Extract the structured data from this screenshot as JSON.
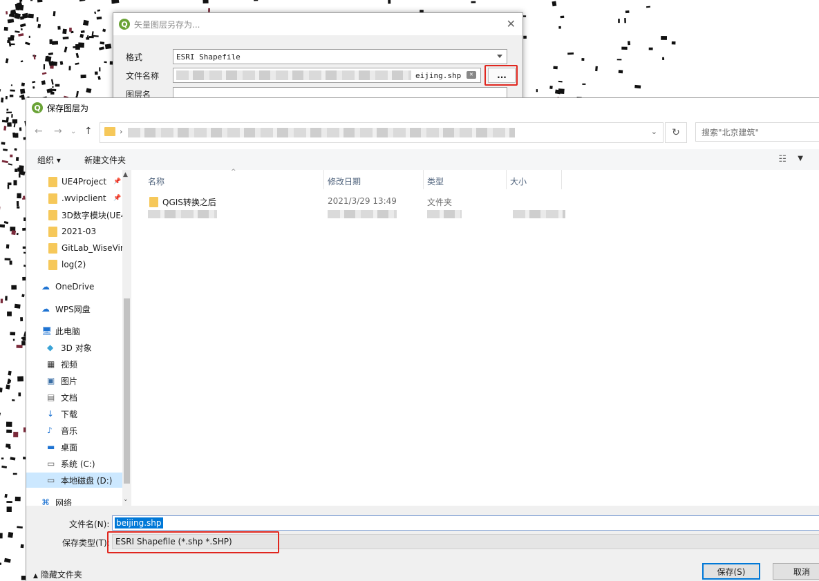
{
  "qgis_dialog": {
    "title": "矢量图层另存为...",
    "format_label": "格式",
    "format_value": "ESRI Shapefile",
    "filename_label": "文件名称",
    "filename_value": "eijing.shp",
    "browse_label": "...",
    "layer_label": "图层名",
    "close_icon": "close-icon"
  },
  "save_dialog": {
    "title": "保存图层为",
    "search_placeholder": "搜索\"北京建筑\"",
    "toolbar": {
      "organize": "组织 ▾",
      "new_folder": "新建文件夹"
    },
    "nav_items": [
      {
        "label": "UE4Project",
        "icon": "folder-icon",
        "pinned": true
      },
      {
        "label": ".wvipclient",
        "icon": "folder-icon",
        "pinned": true
      },
      {
        "label": "3D数字模块(UE4",
        "icon": "folder-icon",
        "pinned": false
      },
      {
        "label": "2021-03",
        "icon": "folder-icon",
        "pinned": false
      },
      {
        "label": "GitLab_WiseVir",
        "icon": "folder-icon",
        "pinned": false
      },
      {
        "label": "log(2)",
        "icon": "folder-icon",
        "pinned": false
      },
      {
        "label": "OneDrive",
        "icon": "cloud-icon",
        "pinned": false
      },
      {
        "label": "WPS网盘",
        "icon": "cloud-icon",
        "pinned": false
      },
      {
        "label": "此电脑",
        "icon": "computer-icon",
        "pinned": false
      },
      {
        "label": "3D 对象",
        "icon": "cube-icon",
        "pinned": false
      },
      {
        "label": "视频",
        "icon": "video-icon",
        "pinned": false
      },
      {
        "label": "图片",
        "icon": "picture-icon",
        "pinned": false
      },
      {
        "label": "文档",
        "icon": "document-icon",
        "pinned": false
      },
      {
        "label": "下载",
        "icon": "download-icon",
        "pinned": false
      },
      {
        "label": "音乐",
        "icon": "music-icon",
        "pinned": false
      },
      {
        "label": "桌面",
        "icon": "desktop-icon",
        "pinned": false
      },
      {
        "label": "系统 (C:)",
        "icon": "drive-icon",
        "pinned": false
      },
      {
        "label": "本地磁盘 (D:)",
        "icon": "drive-icon",
        "pinned": false
      },
      {
        "label": "网络",
        "icon": "network-icon",
        "pinned": false
      }
    ],
    "columns": {
      "name": "名称",
      "date": "修改日期",
      "type": "类型",
      "size": "大小"
    },
    "rows": [
      {
        "name": "QGIS转换之后",
        "date": "2021/3/29 13:49",
        "type": "文件夹",
        "size": ""
      }
    ],
    "filename_label": "文件名(N):",
    "filename_value": "beijing.shp",
    "filetype_label": "保存类型(T):",
    "filetype_value": "ESRI Shapefile (*.shp *.SHP)",
    "hide_folders": "隐藏文件夹",
    "save_button": "保存(S)",
    "cancel_button": "取消"
  },
  "colors": {
    "accent": "#0078d7",
    "highlight": "#e0261e",
    "qgis_green": "#6aa336"
  }
}
